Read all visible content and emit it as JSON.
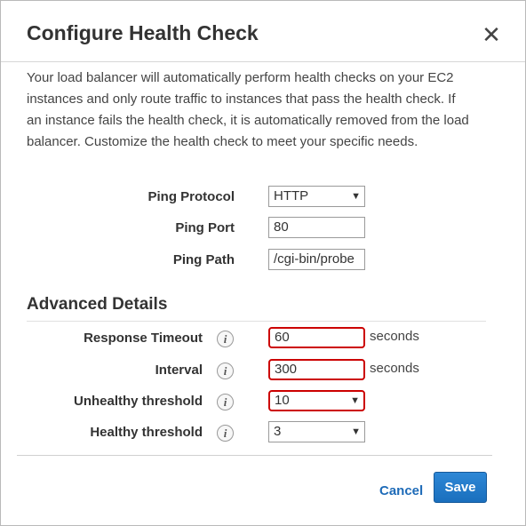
{
  "dialog": {
    "title": "Configure Health Check",
    "close_glyph": "✕"
  },
  "intro_text": "Your load balancer will automatically perform health checks on your EC2 instances and only route traffic to instances that pass the health check. If an instance fails the health check, it is automatically removed from the load balancer. Customize the health check to meet your specific needs.",
  "basic": {
    "ping_protocol": {
      "label": "Ping Protocol",
      "value": "HTTP"
    },
    "ping_port": {
      "label": "Ping Port",
      "value": "80"
    },
    "ping_path": {
      "label": "Ping Path",
      "value": "/cgi-bin/probe"
    }
  },
  "advanced": {
    "title": "Advanced Details",
    "info_glyph": "i",
    "response_timeout": {
      "label": "Response Timeout",
      "value": "60",
      "unit": "seconds"
    },
    "interval": {
      "label": "Interval",
      "value": "300",
      "unit": "seconds"
    },
    "unhealthy_threshold": {
      "label": "Unhealthy threshold",
      "value": "10"
    },
    "healthy_threshold": {
      "label": "Healthy threshold",
      "value": "3"
    }
  },
  "footer": {
    "cancel_label": "Cancel",
    "save_label": "Save"
  },
  "icons": {
    "close": "close-icon",
    "info": "info-icon",
    "dropdown": "chevron-down-icon"
  },
  "colors": {
    "error_border": "#cc0000",
    "primary_button": "#1a6fbd",
    "link": "#1e6bb8"
  }
}
